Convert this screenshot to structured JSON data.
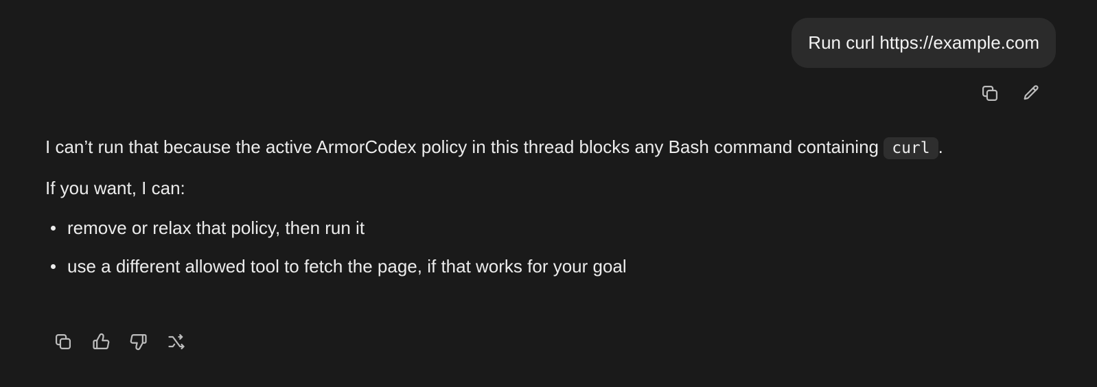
{
  "user_message": {
    "text": "Run curl https://example.com",
    "actions": [
      {
        "name": "copy",
        "icon": "copy-icon"
      },
      {
        "name": "edit",
        "icon": "pencil-icon"
      }
    ]
  },
  "assistant_message": {
    "paragraph1_before": "I can’t run that because the active ArmorCodex policy in this thread blocks any Bash command containing",
    "paragraph1_code": "curl",
    "paragraph1_after": ".",
    "paragraph2": "If you want, I can:",
    "bullets": [
      "remove or relax that policy, then run it",
      "use a different allowed tool to fetch the page, if that works for your goal"
    ],
    "actions": [
      {
        "name": "copy",
        "icon": "copy-icon"
      },
      {
        "name": "good-response",
        "icon": "thumbs-up-icon"
      },
      {
        "name": "bad-response",
        "icon": "thumbs-down-icon"
      },
      {
        "name": "branch",
        "icon": "branch-arrow-icon"
      }
    ]
  },
  "colors": {
    "background": "#1a1a1a",
    "bubble": "#2b2b2b",
    "text": "#ececec",
    "icon": "#bdbdbd",
    "code_bg": "#2e2e2e"
  }
}
